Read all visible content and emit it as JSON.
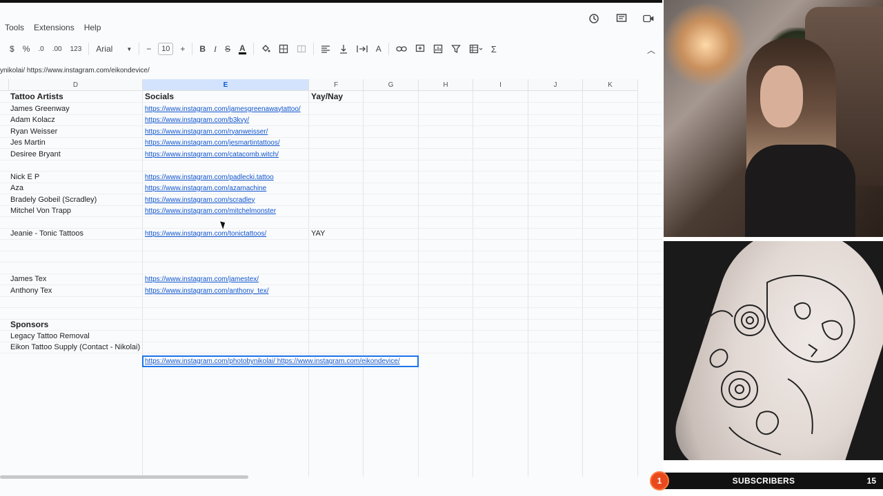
{
  "menu": [
    "Tools",
    "Extensions",
    "Help"
  ],
  "toolbar": {
    "currency": "$",
    "percent": "%",
    "dec_decrease": ".0",
    "dec_increase": ".00",
    "number_format": "123",
    "font": "Arial",
    "font_size": "10",
    "minus": "−",
    "plus": "+",
    "bold": "B",
    "italic": "I",
    "strike": "S",
    "text_color": "A",
    "sum": "Σ"
  },
  "formula_text": "ynikolai/ https://www.instagram.com/eikondevice/",
  "columns": [
    {
      "label": "D",
      "selected": false
    },
    {
      "label": "E",
      "selected": true
    },
    {
      "label": "F",
      "selected": false
    },
    {
      "label": "G",
      "selected": false
    },
    {
      "label": "H",
      "selected": false
    },
    {
      "label": "I",
      "selected": false
    },
    {
      "label": "J",
      "selected": false
    },
    {
      "label": "K",
      "selected": false
    }
  ],
  "sheet_rows": [
    {
      "d": "Tattoo Artists",
      "e": "Socials",
      "f": "Yay/Nay",
      "header": true
    },
    {
      "d": "James Greenway",
      "e": "https://www.instagram.com/jamesgreenawaytattoo/",
      "f": ""
    },
    {
      "d": "Adam Kolacz",
      "e": "https://www.instagram.com/b3kvy/",
      "f": ""
    },
    {
      "d": "Ryan Weisser",
      "e": "https://www.instagram.com/ryanweisser/",
      "f": ""
    },
    {
      "d": "Jes Martin",
      "e": "https://www.instagram.com/jesmartintattoos/",
      "f": ""
    },
    {
      "d": "Desiree Bryant",
      "e": "https://www.instagram.com/catacomb.witch/",
      "f": ""
    },
    {
      "d": "",
      "e": "",
      "f": ""
    },
    {
      "d": "Nick E P",
      "e": "https://www.instagram.com/padlecki.tattoo",
      "f": ""
    },
    {
      "d": "Aza",
      "e": "https://www.instagram.com/azamachine",
      "f": ""
    },
    {
      "d": "Bradely Gobeil (Scradley)",
      "e": "https://www.instagram.com/scradley",
      "f": ""
    },
    {
      "d": "Mitchel Von Trapp",
      "e": "https://www.instagram.com/mitchelmonster",
      "f": ""
    },
    {
      "d": "",
      "e": "",
      "f": ""
    },
    {
      "d": "Jeanie - Tonic Tattoos",
      "e": "https://www.instagram.com/tonictattoos/",
      "f": "YAY"
    },
    {
      "d": "",
      "e": "",
      "f": ""
    },
    {
      "d": "",
      "e": "",
      "f": ""
    },
    {
      "d": "",
      "e": "",
      "f": ""
    },
    {
      "d": "James Tex",
      "e": "https://www.instagram.com/jamestex/",
      "f": ""
    },
    {
      "d": "Anthony Tex",
      "e": "https://www.instagram.com/anthony_tex/",
      "f": ""
    },
    {
      "d": "",
      "e": "",
      "f": ""
    },
    {
      "d": "",
      "e": "",
      "f": ""
    },
    {
      "d": "Sponsors",
      "e": "",
      "f": "",
      "header": true
    },
    {
      "d": "Legacy Tattoo Removal",
      "e": "",
      "f": ""
    },
    {
      "d": "Eikon Tattoo Supply (Contact - Nikolai)",
      "e": "",
      "f": ""
    }
  ],
  "active_cell_value": "https://www.instagram.com/photobynikolai/ https://www.instagram.com/eikondevice/",
  "overlay": {
    "subscribers_label": "SUBSCRIBERS",
    "subscribers_count": "15",
    "badge": "1",
    "badge_color": "#e8491d"
  },
  "colors": {
    "link": "#1155cc",
    "selection": "#1a73e8",
    "column_highlight": "#d3e3fd"
  }
}
